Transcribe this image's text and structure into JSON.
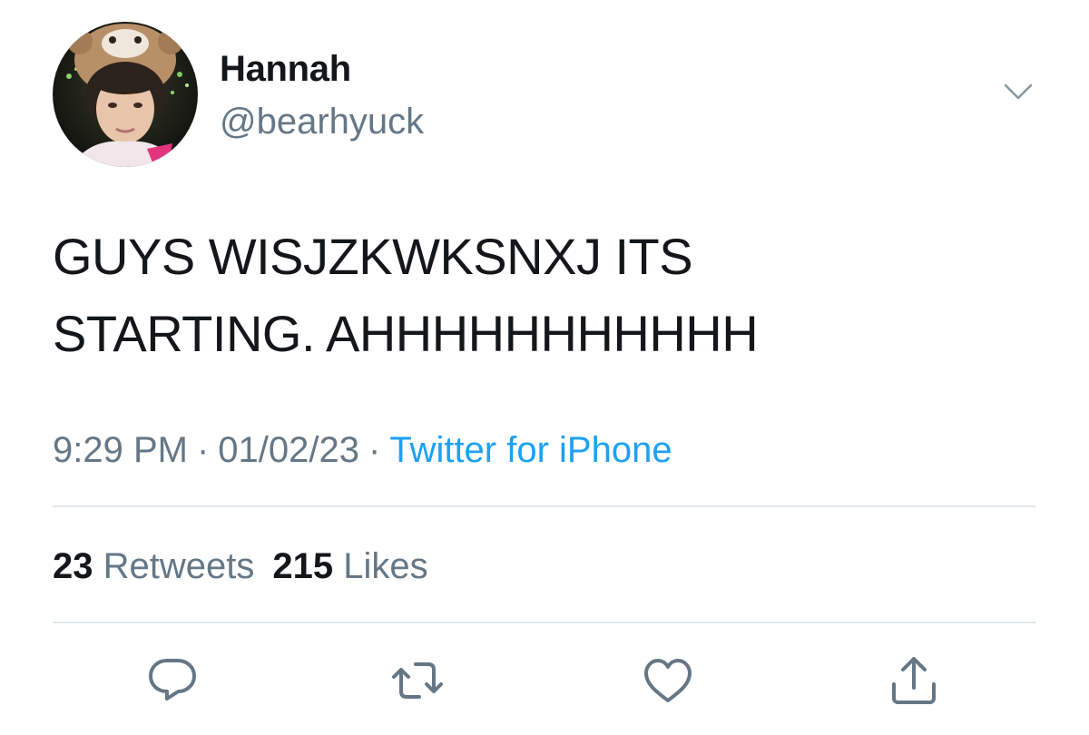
{
  "user": {
    "display_name": "Hannah",
    "handle": "@bearhyuck"
  },
  "tweet": {
    "text": "GUYS WISJZKWKSNXJ ITS\nSTARTING. AHHHHHHHHHHH",
    "time": "9:29 PM",
    "date": "01/02/23",
    "separator": "·",
    "source": "Twitter for iPhone"
  },
  "stats": {
    "retweets_count": "23",
    "retweets_label": "Retweets",
    "likes_count": "215",
    "likes_label": "Likes"
  },
  "icons": {
    "more": "chevron-down-icon",
    "reply": "reply-icon",
    "retweet": "retweet-icon",
    "like": "heart-icon",
    "share": "share-icon"
  },
  "colors": {
    "text_primary": "#14171a",
    "text_secondary": "#657786",
    "link": "#1da1f2",
    "divider": "#e1e8ed"
  }
}
